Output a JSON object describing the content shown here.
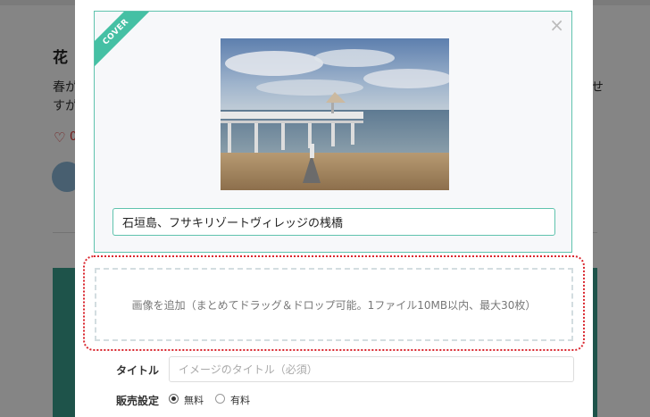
{
  "background": {
    "post_title_partial": "花",
    "body_line1": "春が",
    "body_line2": "すが",
    "right_char": "せ",
    "like_count_partial": "0"
  },
  "modal": {
    "cover_badge": "COVER",
    "close_glyph": "×",
    "image_caption_value": "石垣島、フサキリゾートヴィレッジの桟橋",
    "dropzone_text": "画像を追加（まとめてドラッグ＆ドロップ可能。1ファイル10MB以内、最大30枚）",
    "title_label": "タイトル",
    "title_placeholder": "イメージのタイトル（必須）",
    "sale_label": "販売設定",
    "sale_options": [
      {
        "label": "無料",
        "selected": true
      },
      {
        "label": "有料",
        "selected": false
      }
    ]
  },
  "colors": {
    "accent": "#45c0a4",
    "highlight_outline": "#d9262e"
  },
  "icons": {
    "close": "close-icon",
    "like": "heart-icon"
  }
}
